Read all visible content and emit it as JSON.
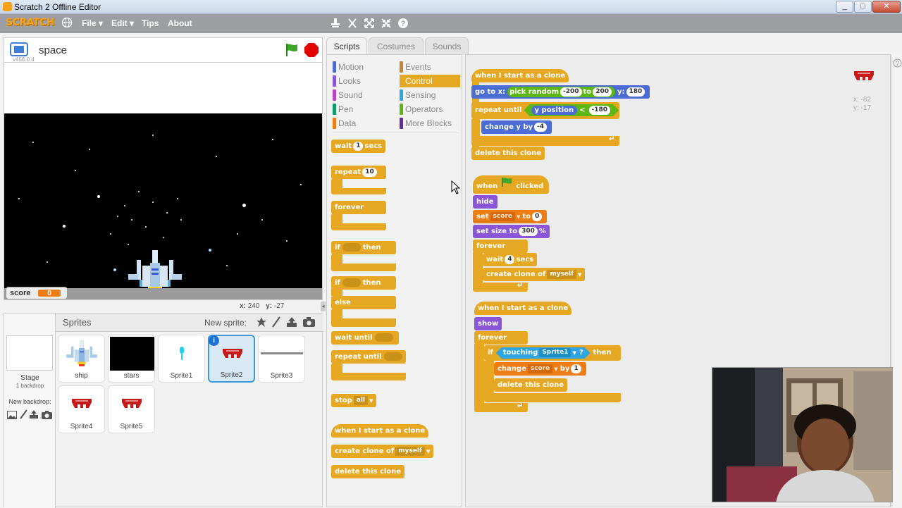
{
  "window": {
    "title": "Scratch 2 Offline Editor",
    "controls": [
      "_",
      "□",
      "✕"
    ]
  },
  "menubar": {
    "logo": "SCRATCH",
    "items": [
      "File ▾",
      "Edit ▾",
      "Tips",
      "About"
    ]
  },
  "stage": {
    "project_name": "space",
    "version": "v456.0.4",
    "monitor_label": "score",
    "monitor_value": "0",
    "x_label": "x:",
    "x_value": "240",
    "y_label": "y:",
    "y_value": "-27"
  },
  "sprites_pane": {
    "title": "Sprites",
    "new_sprite_label": "New sprite:",
    "stage_label": "Stage",
    "stage_sub": "1 backdrop",
    "new_backdrop_label": "New backdrop:",
    "sprites": [
      "ship",
      "stars",
      "Sprite1",
      "Sprite2",
      "Sprite3",
      "Sprite4",
      "Sprite5"
    ],
    "info_badge": "i"
  },
  "tabs": [
    "Scripts",
    "Costumes",
    "Sounds"
  ],
  "categories": {
    "left": [
      {
        "label": "Motion",
        "color": "#4a6cd4"
      },
      {
        "label": "Looks",
        "color": "#8a55d7"
      },
      {
        "label": "Sound",
        "color": "#bb42c3"
      },
      {
        "label": "Pen",
        "color": "#0e9a6c"
      },
      {
        "label": "Data",
        "color": "#ee7d16"
      }
    ],
    "right": [
      {
        "label": "Events",
        "color": "#c88330"
      },
      {
        "label": "Control",
        "color": "#e6a822"
      },
      {
        "label": "Sensing",
        "color": "#2ca5e2"
      },
      {
        "label": "Operators",
        "color": "#5cb712"
      },
      {
        "label": "More Blocks",
        "color": "#632d99"
      }
    ]
  },
  "palette_blocks": {
    "wait": "wait",
    "wait_val": "1",
    "wait_secs": "secs",
    "repeat": "repeat",
    "repeat_val": "10",
    "forever": "forever",
    "if": "if",
    "then": "then",
    "else": "else",
    "wait_until": "wait until",
    "repeat_until": "repeat until",
    "stop": "stop",
    "stop_val": "all",
    "when_clone": "when I start as a clone",
    "create_clone": "create clone of",
    "create_clone_val": "myself",
    "delete_clone": "delete this clone"
  },
  "script1": {
    "hat": "when I start as a clone",
    "goto": "go to x:",
    "pick_random": "pick random",
    "r1": "-200",
    "to": "to",
    "r2": "200",
    "y": "y:",
    "yval": "180",
    "repeat_until": "repeat until",
    "ypos": "y position",
    "lt": "<",
    "ltval": "-180",
    "change_y": "change y by",
    "change_val": "-4",
    "delete": "delete this clone"
  },
  "script2": {
    "when": "when",
    "clicked": "clicked",
    "hide": "hide",
    "set": "set",
    "var": "score",
    "to": "to",
    "val": "0",
    "set_size": "set size to",
    "size_val": "300",
    "pct": "%",
    "forever": "forever",
    "wait": "wait",
    "wait_val": "4",
    "secs": "secs",
    "create_clone": "create clone of",
    "myself": "myself"
  },
  "script3": {
    "hat": "when I start as a clone",
    "show": "show",
    "forever": "forever",
    "if": "if",
    "touching": "touching",
    "target": "Sprite1",
    "q": "?",
    "then": "then",
    "change": "change",
    "var": "score",
    "by": "by",
    "val": "1",
    "delete": "delete this clone"
  },
  "script_area": {
    "x_label": "x: -82",
    "y_label": "y: -17"
  },
  "colors": {
    "control": "#e6a822",
    "motion": "#4a6cd4",
    "operators": "#5cb712",
    "sensing": "#2ca5e2",
    "data": "#ee7d16",
    "looks": "#8a55d7"
  }
}
